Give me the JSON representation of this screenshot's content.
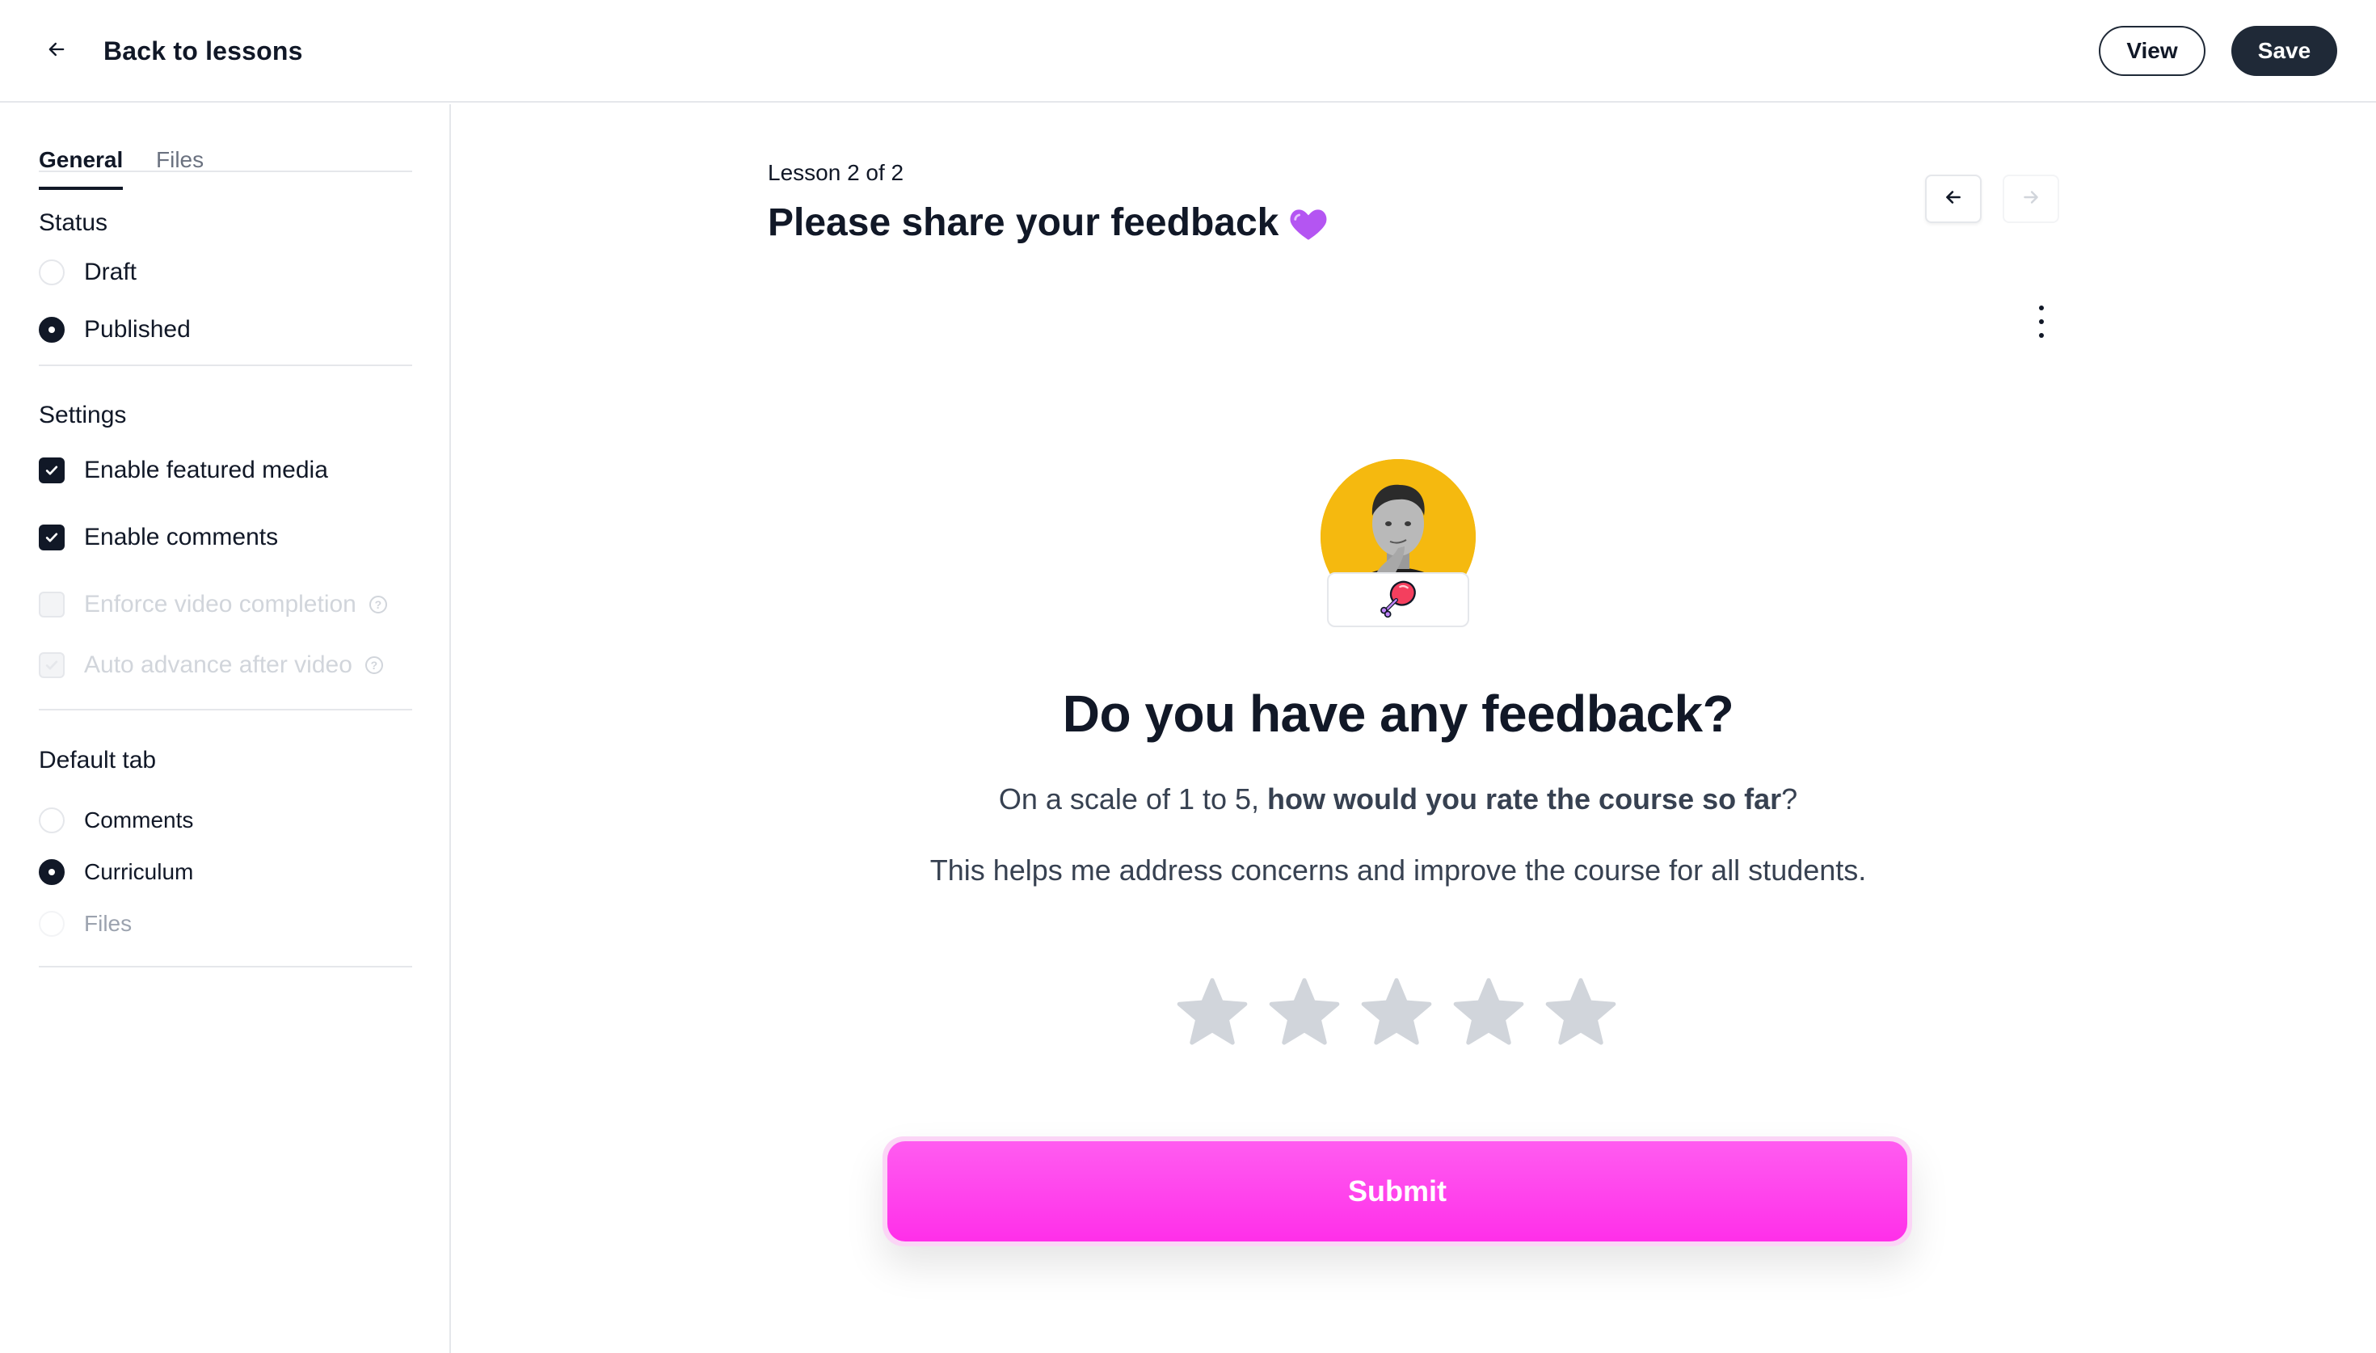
{
  "header": {
    "back_label": "Back to lessons",
    "view_label": "View",
    "save_label": "Save"
  },
  "sidebar": {
    "tabs": [
      {
        "label": "General",
        "active": true
      },
      {
        "label": "Files",
        "active": false
      }
    ],
    "status": {
      "title": "Status",
      "options": [
        {
          "label": "Draft",
          "selected": false
        },
        {
          "label": "Published",
          "selected": true
        }
      ]
    },
    "settings": {
      "title": "Settings",
      "options": [
        {
          "label": "Enable featured media",
          "checked": true,
          "disabled": false
        },
        {
          "label": "Enable comments",
          "checked": true,
          "disabled": false
        },
        {
          "label": "Enforce video completion",
          "checked": false,
          "disabled": true
        },
        {
          "label": "Auto advance after video",
          "checked": false,
          "disabled": true
        }
      ]
    },
    "default_tab": {
      "title": "Default tab",
      "options": [
        {
          "label": "Comments",
          "selected": false,
          "disabled": false
        },
        {
          "label": "Curriculum",
          "selected": true,
          "disabled": false
        },
        {
          "label": "Files",
          "selected": false,
          "disabled": true
        }
      ]
    }
  },
  "main": {
    "lesson_meta": "Lesson 2 of 2",
    "lesson_title": "Please share your feedback",
    "title_emoji": "purple-heart-icon",
    "question_title": "Do you have any feedback?",
    "question_line1_prefix": "On a scale of 1 to 5, ",
    "question_line1_bold": "how would you rate the course so far",
    "question_line1_suffix": "?",
    "question_line2": "This helps me address concerns and improve the course for all students.",
    "rating": {
      "max": 5,
      "value": 0
    },
    "submit_label": "Submit"
  },
  "colors": {
    "primary_dark": "#1f2937",
    "accent_pink": "#ff3ded",
    "star_inactive": "#d1d5db",
    "avatar_bg": "#f5b90f",
    "heart": "#a855f7"
  }
}
